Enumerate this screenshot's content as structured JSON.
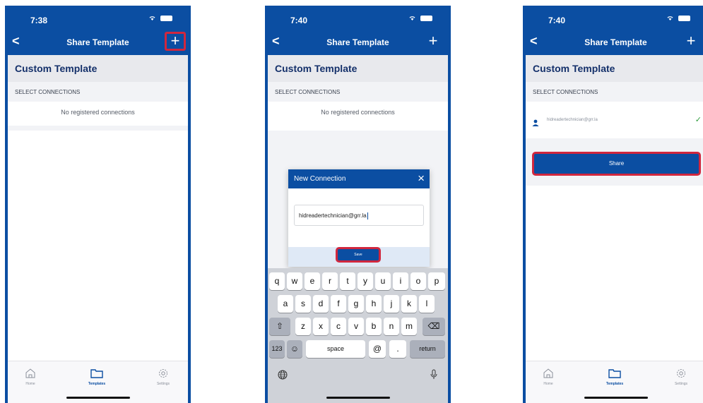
{
  "screens": [
    {
      "time": "7:38",
      "nav_title": "Share Template",
      "back": "<",
      "plus": "+",
      "template_name": "Custom Template",
      "section_label": "SELECT CONNECTIONS",
      "empty_message": "No registered connections",
      "tabs": [
        {
          "label": "Home",
          "icon": "home-icon"
        },
        {
          "label": "Templates",
          "icon": "folder-icon"
        },
        {
          "label": "Settings",
          "icon": "gear-icon"
        }
      ]
    },
    {
      "time": "7:40",
      "nav_title": "Share Template",
      "back": "<",
      "plus": "+",
      "template_name": "Custom Template",
      "section_label": "SELECT CONNECTIONS",
      "empty_message": "No registered connections",
      "dialog": {
        "title": "New Connection",
        "close": "×",
        "input_value": "hidreadertechnician@grr.la",
        "save_label": "Save"
      },
      "keyboard": {
        "row1": [
          "q",
          "w",
          "e",
          "r",
          "t",
          "y",
          "u",
          "i",
          "o",
          "p"
        ],
        "row2": [
          "a",
          "s",
          "d",
          "f",
          "g",
          "h",
          "j",
          "k",
          "l"
        ],
        "row3": [
          "z",
          "x",
          "c",
          "v",
          "b",
          "n",
          "m"
        ],
        "shift": "⇧",
        "backspace": "⌫",
        "numbers": "123",
        "emoji": "☺",
        "space": "space",
        "at": "@",
        "dot": ".",
        "return": "return",
        "globe": "🌐",
        "mic": "🎤"
      }
    },
    {
      "time": "7:40",
      "nav_title": "Share Template",
      "back": "<",
      "plus": "+",
      "template_name": "Custom Template",
      "section_label": "SELECT CONNECTIONS",
      "connection_email": "hidreadertechnician@grr.la",
      "check": "✓",
      "share_label": "Share",
      "tabs": [
        {
          "label": "Home",
          "icon": "home-icon"
        },
        {
          "label": "Templates",
          "icon": "folder-icon"
        },
        {
          "label": "Settings",
          "icon": "gear-icon"
        }
      ]
    }
  ],
  "colors": {
    "brand_blue": "#0b4ea2",
    "highlight_red": "#d0273e",
    "check_green": "#2e9b3b"
  }
}
